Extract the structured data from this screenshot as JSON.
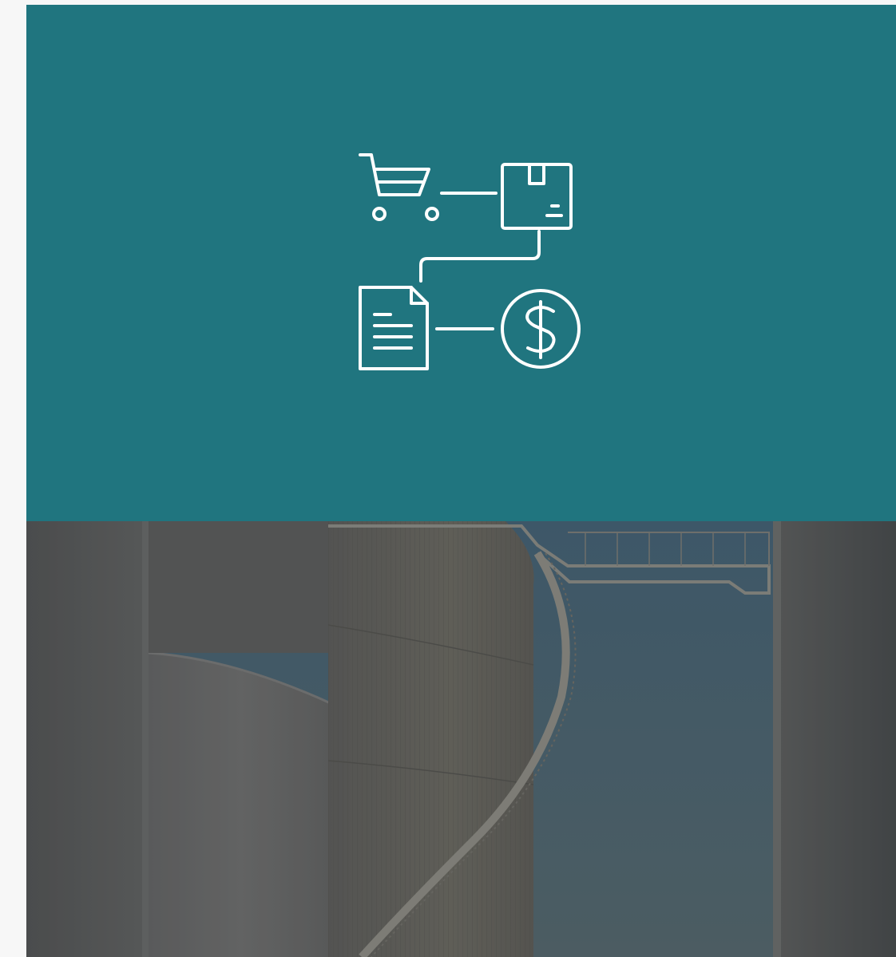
{
  "hero": {
    "background_color": "#20757f",
    "icon": "purchase-to-pay-process-icon",
    "icon_parts": [
      "cart-icon",
      "package-icon",
      "invoice-document-icon",
      "dollar-coin-icon"
    ]
  },
  "photo": {
    "subject": "industrial-storage-tanks-photo",
    "overlay_color": "#3a3a3a"
  }
}
